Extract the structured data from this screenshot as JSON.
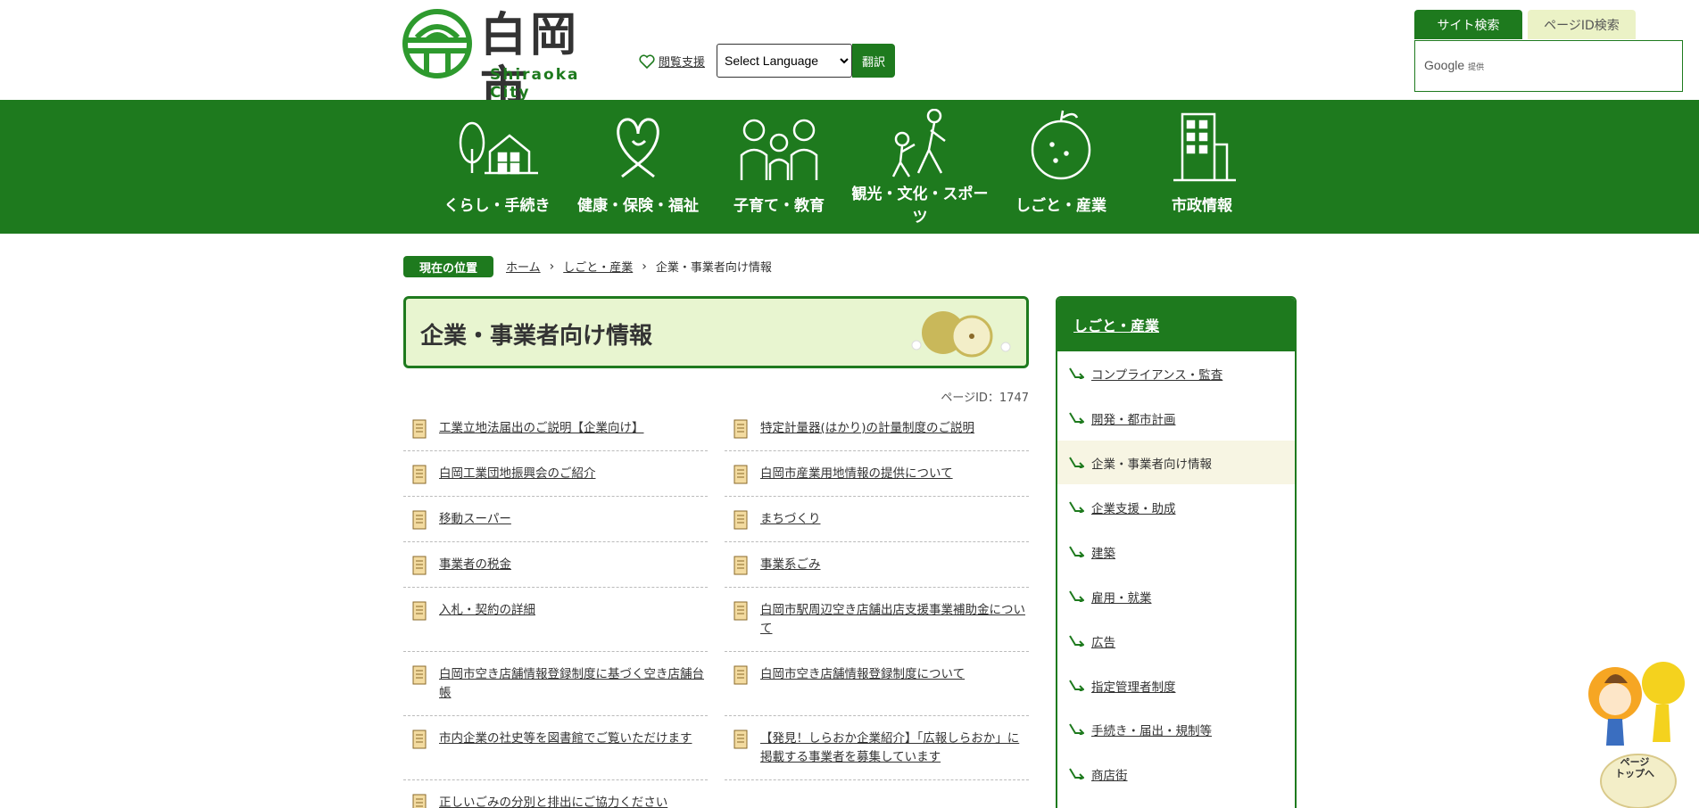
{
  "header": {
    "logo_jp": "白岡市",
    "logo_en": "Shiraoka City",
    "assist_label": "閲覧支援",
    "language_select": "Select Language",
    "translate_label": "翻訳",
    "search_tabs": [
      "サイト検索",
      "ページID検索"
    ],
    "google_label": "Google",
    "google_suffix": "提供"
  },
  "nav": [
    {
      "label": "くらし・手続き",
      "icon": "house-tree-icon"
    },
    {
      "label": "健康・保険・福祉",
      "icon": "heart-icon"
    },
    {
      "label": "子育て・教育",
      "icon": "family-icon"
    },
    {
      "label": "観光・文化・スポーツ",
      "icon": "walking-people-icon"
    },
    {
      "label": "しごと・産業",
      "icon": "pear-icon"
    },
    {
      "label": "市政情報",
      "icon": "building-icon"
    }
  ],
  "breadcrumb": {
    "badge": "現在の位置",
    "items": [
      "ホーム",
      "しごと・産業",
      "企業・事業者向け情報"
    ]
  },
  "page": {
    "title": "企業・事業者向け情報",
    "page_id": "ページID：1747"
  },
  "links": [
    "工業立地法届出のご説明【企業向け】",
    "特定計量器(はかり)の計量制度のご説明",
    "白岡工業団地振興会のご紹介",
    "白岡市産業用地情報の提供について",
    "移動スーパー",
    "まちづくり",
    "事業者の税金",
    "事業系ごみ",
    "入札・契約の詳細",
    "白岡市駅周辺空き店舗出店支援事業補助金について",
    "白岡市空き店舗情報登録制度に基づく空き店舗台帳",
    "白岡市空き店舗情報登録制度について",
    "市内企業の社史等を図書館でご覧いただけます",
    "【発見！しらおか企業紹介】「広報しらおか」に掲載する事業者を募集しています",
    "正しいごみの分別と排出にご協力ください"
  ],
  "sidebar": {
    "heading": "しごと・産業",
    "items": [
      "コンプライアンス・監査",
      "開発・都市計画",
      "企業・事業者向け情報",
      "企業支援・助成",
      "建築",
      "雇用・就業",
      "広告",
      "指定管理者制度",
      "手続き・届出・規制等",
      "商店街"
    ],
    "current_index": 2
  },
  "pagetop": {
    "label_line1": "ページ",
    "label_line2": "トップへ"
  },
  "colors": {
    "brand_green": "#1e7a1e",
    "title_bg": "#e8f5d0",
    "tab_inactive": "#ebf2c6"
  }
}
